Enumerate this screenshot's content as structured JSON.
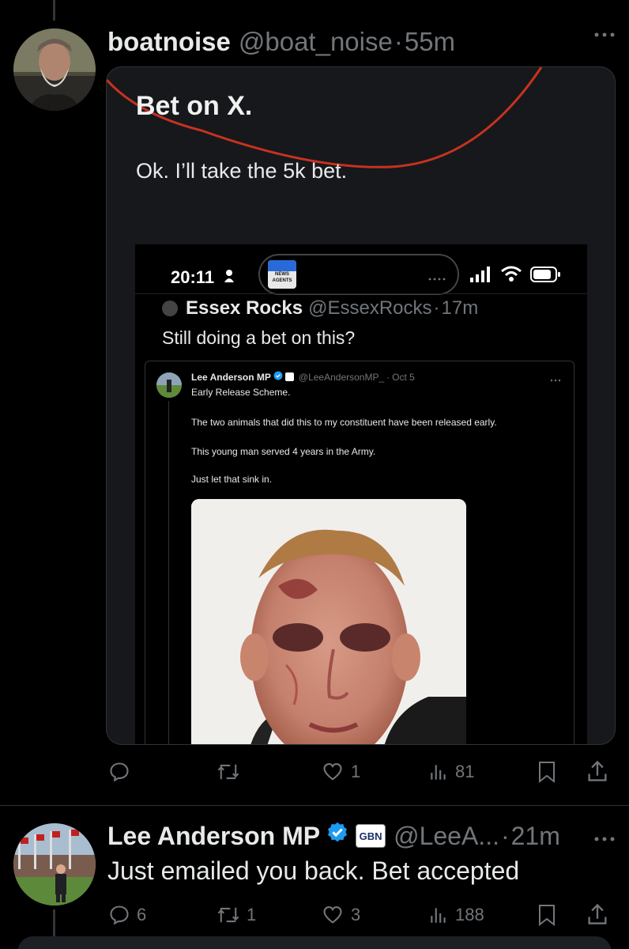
{
  "tweet1": {
    "display_name": "boatnoise",
    "handle": "@boat_noise",
    "separator": "·",
    "time": "55m",
    "more_icon": "more-horizontal-icon",
    "quote": {
      "heading": "Bet on X.",
      "body": "Ok. I’ll take the 5k bet.",
      "phone": {
        "time": "20:11",
        "status_badge": "NEWS AGENTS",
        "inner_tweet": {
          "name": "Essex Rocks",
          "handle": "@EssexRocks",
          "separator": "·",
          "time": "17m",
          "text": "Still doing a bet on this?",
          "nested_quote": {
            "name": "Lee Anderson MP",
            "handle": "@LeeAndersonMP_",
            "separator": "·",
            "date": "Oct 5",
            "line1": "Early Release Scheme.",
            "line2": "The two animals that did this to my constituent have been released early.",
            "line3": "This young man served 4 years in the Army.",
            "line4": "Just let that sink in."
          }
        }
      }
    },
    "actions": {
      "reply_count": "",
      "repost_count": "",
      "like_count": "1",
      "views_count": "81"
    }
  },
  "tweet2": {
    "display_name": "Lee Anderson MP",
    "affiliate_badge": "GBN",
    "handle": "@LeeA...",
    "separator": "·",
    "time": "21m",
    "text": "Just emailed you back. Bet accepted",
    "actions": {
      "reply_count": "6",
      "repost_count": "1",
      "like_count": "3",
      "views_count": "188"
    }
  },
  "colors": {
    "background": "#000000",
    "text_primary": "#e7e9ea",
    "text_muted": "#71767b",
    "verified_blue": "#1d9bf0",
    "annotation_red": "#c8321e"
  }
}
